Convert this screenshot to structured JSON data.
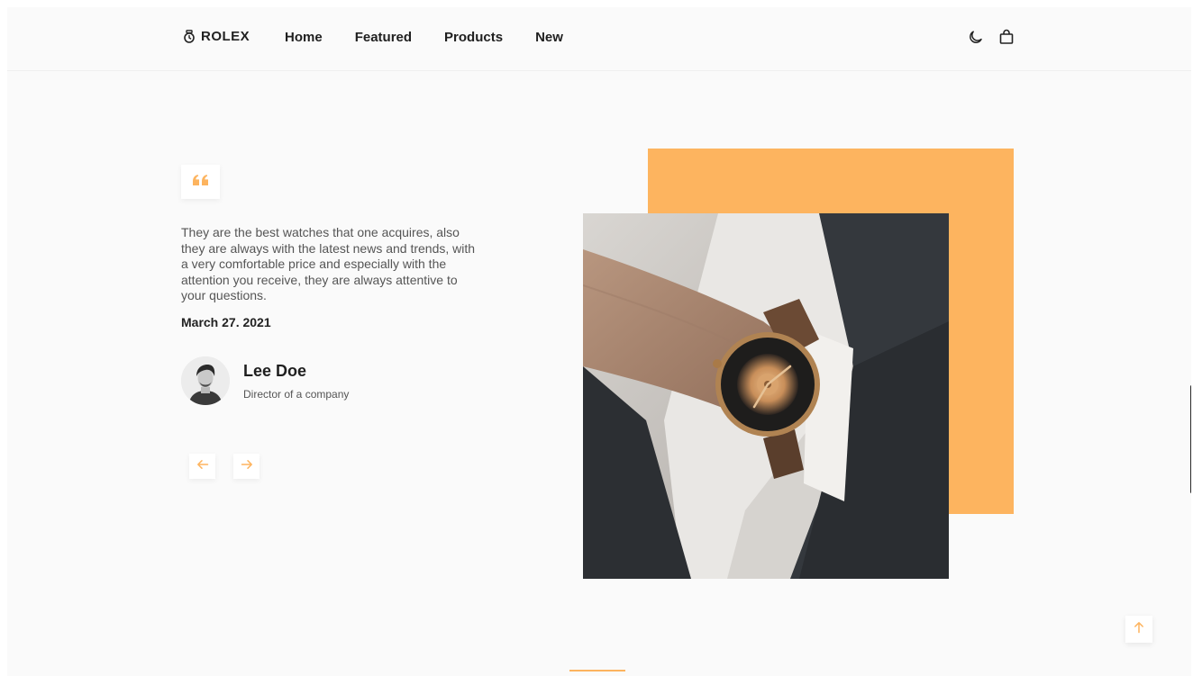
{
  "header": {
    "brand": "ROLEX",
    "nav": [
      "Home",
      "Featured",
      "Products",
      "New"
    ],
    "icons": [
      "moon-icon",
      "shopping-bag-icon"
    ]
  },
  "testimonial": {
    "quote_icon": "quote-icon",
    "text": "They are the best watches that one acquires, also they are always with the latest news and trends, with a very comfortable price and especially with the attention you receive, they are always attentive to your questions.",
    "date": "March 27. 2021",
    "name": "Lee Doe",
    "role": "Director of a company"
  },
  "controls": {
    "prev_icon": "arrow-left-icon",
    "next_icon": "arrow-right-icon",
    "scroll_up_icon": "arrow-up-icon"
  },
  "colors": {
    "accent": "#fdb45f",
    "background": "#fafafa",
    "text": "#1f1f1f"
  }
}
